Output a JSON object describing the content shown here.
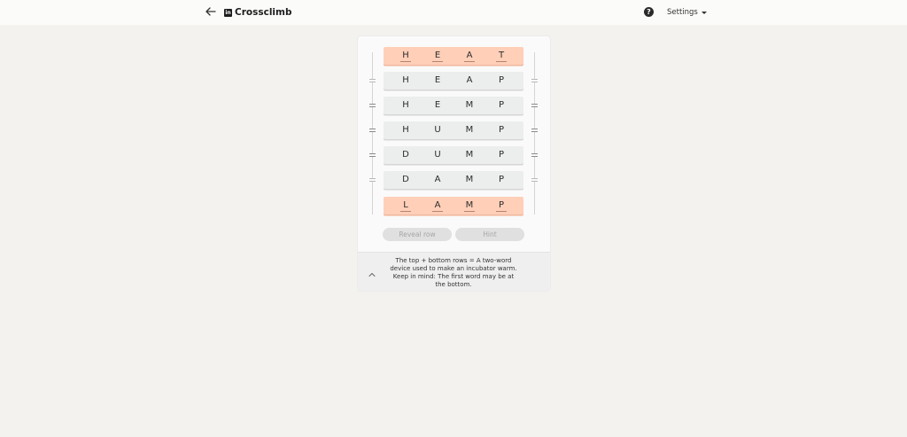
{
  "header": {
    "brand_logo": "in",
    "title": "Crossclimb",
    "help_glyph": "?",
    "settings_label": "Settings"
  },
  "board": {
    "rows": [
      {
        "letters": [
          "H",
          "E",
          "A",
          "T"
        ],
        "locked": true
      },
      {
        "letters": [
          "H",
          "E",
          "A",
          "P"
        ],
        "locked": false
      },
      {
        "letters": [
          "H",
          "E",
          "M",
          "P"
        ],
        "locked": false
      },
      {
        "letters": [
          "H",
          "U",
          "M",
          "P"
        ],
        "locked": false
      },
      {
        "letters": [
          "D",
          "U",
          "M",
          "P"
        ],
        "locked": false
      },
      {
        "letters": [
          "D",
          "A",
          "M",
          "P"
        ],
        "locked": false
      },
      {
        "letters": [
          "L",
          "A",
          "M",
          "P"
        ],
        "locked": true
      }
    ]
  },
  "buttons": {
    "reveal_row": "Reveal row",
    "hint": "Hint"
  },
  "clue": {
    "text": "The top + bottom rows = A two-word device used to make an incubator warm. Keep in mind: The first word may be at the bottom."
  },
  "colors": {
    "background": "#f3f2ef",
    "locked_row": "#ffcfb8",
    "row": "#eceded",
    "button_disabled": "#e0e0e0"
  }
}
